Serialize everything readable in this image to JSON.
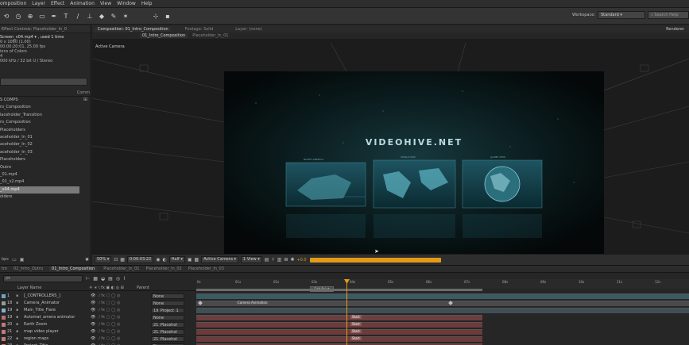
{
  "menu": [
    "omposition",
    "Layer",
    "Effect",
    "Animation",
    "View",
    "Window",
    "Help"
  ],
  "toolbar": {
    "workspace_label": "Workspace:",
    "workspace_value": "Standard",
    "search_placeholder": "Search Help"
  },
  "left_panel": {
    "tab": "Effect Controls: Placeholder_In_0",
    "info": [
      "Screen_v04.mp4 ▾ , used 1 time",
      "0 x 1080 (1.00)",
      "00:00:20:01, 25.00 fps",
      "ions of Colors",
      "4",
      "000 kHz / 32 bit U / Stereo"
    ],
    "items": [
      {
        "label": "S COMPS",
        "selected": false
      },
      {
        "label": "ro_Composition",
        "selected": false
      },
      {
        "label": "laceholder_Transition",
        "selected": false
      },
      {
        "label": "ro_Composition",
        "selected": false
      },
      {
        "label": "Placeholders",
        "selected": false
      },
      {
        "label": "aceholder_In_01",
        "selected": false
      },
      {
        "label": "aceholder_In_02",
        "selected": false
      },
      {
        "label": "aceholder_In_03",
        "selected": false
      },
      {
        "label": "Placeholders",
        "selected": false
      },
      {
        "label": "Outro",
        "selected": false
      },
      {
        "label": "_01.mp4",
        "selected": false
      },
      {
        "label": "_01_v2.mp4",
        "selected": false
      },
      {
        "label": "_v04.mp4",
        "selected": true
      },
      {
        "label": "olders",
        "selected": false
      }
    ],
    "col_hint": "Comm",
    "bpc": "bpc"
  },
  "viewer": {
    "tabs": [
      "Composition: 01_Intro_Composition",
      "Footage: Solid",
      "Layer: (none)"
    ],
    "subtabs": [
      "01_Intro_Composition",
      "Placeholder_In_01"
    ],
    "renderer": "Renderer",
    "camera_label": "Active Camera",
    "comp_title": "VIDEOHIVE.NET",
    "panel_captions": [
      "NORTH AMERICA",
      "WORLD MAP",
      "GLOBE VIEW"
    ]
  },
  "viewer_bar": {
    "zoom": "50%",
    "timecode": "0:00:03:22",
    "resolution": "Half",
    "camera": "Active Camera",
    "view": "1 View",
    "exposure": "+0.0"
  },
  "timeline": {
    "tabs": [
      "tro",
      "02_Intro_Outro",
      "01_Intro_Composition",
      "Placeholder_In_01",
      "Placeholder_In_02",
      "Placeholder_In_03"
    ],
    "active_tab": 2,
    "search_placeholder": "ρ▾",
    "header": {
      "layer_name": "Layer Name",
      "parent": "Parent"
    },
    "ruler": [
      "0s",
      "01s",
      "02s",
      "03s",
      "04s",
      "05s",
      "06s",
      "07s",
      "08s",
      "09s",
      "10s",
      "11s",
      "12s"
    ],
    "edit_point_label": "Edit Point",
    "camera_marker": "Camera Animation",
    "layers": [
      {
        "num": "1",
        "name": "[_CONTROLLERS_]",
        "parent": "None",
        "color": "#6aa5c8",
        "bar": "#3b5b63"
      },
      {
        "num": "18",
        "name": "Camera_Animator",
        "parent": "None",
        "color": "#9a9a9a",
        "bar": "#4a4a4a"
      },
      {
        "num": "19",
        "name": "Main_Title_Flare",
        "parent": "19_Project_1",
        "color": "#7fb6c9",
        "bar": "#3f4f55"
      },
      {
        "num": "19",
        "name": "Automat_amera animator",
        "parent": "None",
        "color": "#b87070",
        "bar": "#6b3f3f"
      },
      {
        "num": "20",
        "name": "Earth Zoom",
        "parent": "21_Placehol",
        "color": "#c07a7a",
        "bar": "#6e3a3a"
      },
      {
        "num": "21",
        "name": "map video player",
        "parent": "21_Placehol",
        "color": "#c07a7a",
        "bar": "#6e3a3a"
      },
      {
        "num": "22",
        "name": "region maps",
        "parent": "21_Placehol",
        "color": "#c07a7a",
        "bar": "#6e3a3a"
      },
      {
        "num": "23",
        "name": "Project_Title",
        "parent": "None",
        "color": "#c07a7a",
        "bar": "#6e3a3a"
      }
    ],
    "key_labels": [
      "Start",
      "Start",
      "Start",
      "Start"
    ]
  },
  "colors": {
    "accent_orange": "#e39a16",
    "current_time_marker": "#e59a1b",
    "selection": "#7a7a7a"
  }
}
